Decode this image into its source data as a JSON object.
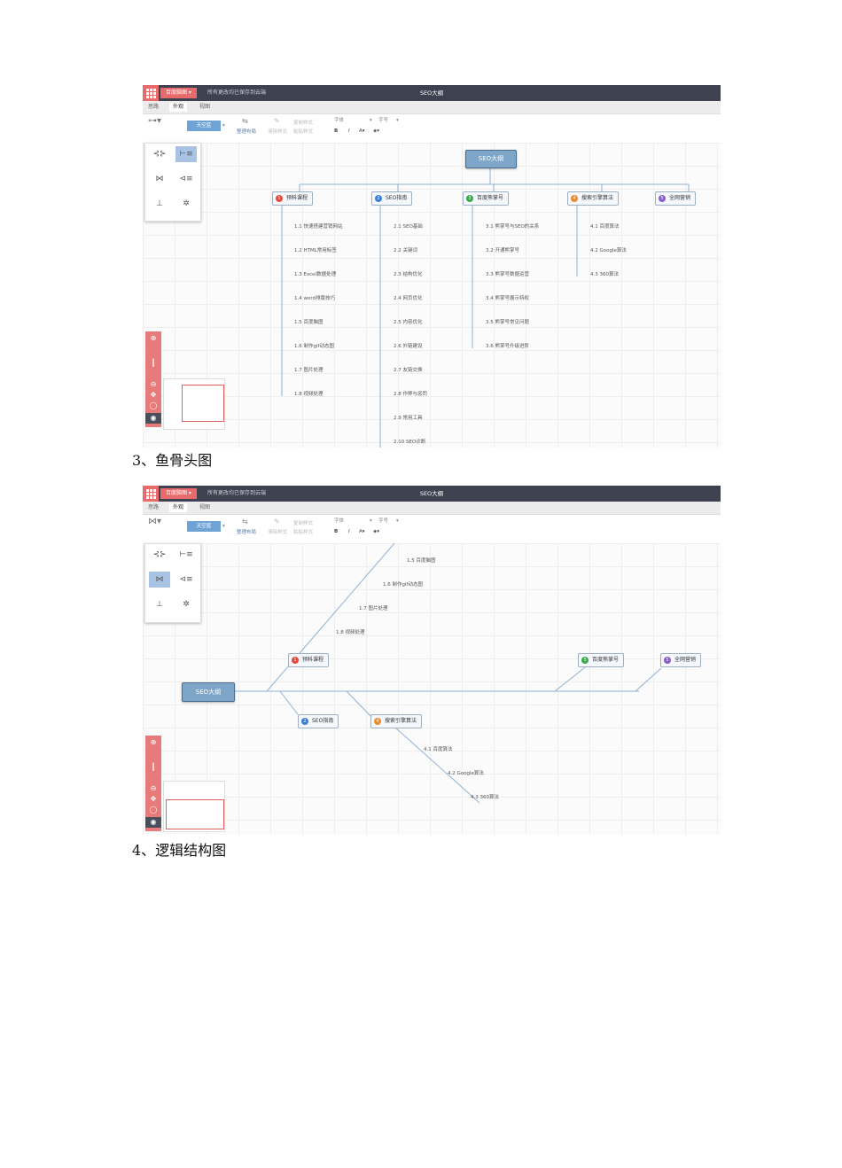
{
  "app": {
    "brand": "百度脑图 ▾",
    "save_status": "所有更改均已保存到云端",
    "doc_title": "SEO大纲",
    "tabs": [
      "思路",
      "外观",
      "视图"
    ],
    "toolbar": {
      "theme_button": "天空蓝",
      "arrange": "整理布局",
      "clear_style": "清除样式",
      "copy_style": "复制样式",
      "paste_style": "粘贴样式",
      "font_label": "字体",
      "size_label": "字号",
      "bold": "B",
      "italic": "I",
      "font_color": "A▾"
    }
  },
  "colors": {
    "titlebar": "#3d4150",
    "accent": "#e86a6a",
    "node_border": "#9fb0c4",
    "root": "#7ea6c8"
  },
  "mindmap": {
    "root": "SEO大纲",
    "branches": [
      {
        "num": "1",
        "label": "预科课程",
        "color": "#e24a3b",
        "items": [
          "1.1 快速搭建营销网站",
          "1.2 HTML常用标签",
          "1.3 Excel数据处理",
          "1.4 word排版技巧",
          "1.5 百度脑图",
          "1.6 制作gif动态图",
          "1.7 图片处理",
          "1.8 视频处理"
        ]
      },
      {
        "num": "2",
        "label": "SEO指南",
        "color": "#3b7fd6",
        "items": [
          "2.1 SEO基础",
          "2.2 关键词",
          "2.3 结构优化",
          "2.4 网页优化",
          "2.5 内容优化",
          "2.6 外链建设",
          "2.7 友链交换",
          "2.8 作弊与惩罚",
          "2.9 常用工具",
          "2.10 SEO诊断"
        ]
      },
      {
        "num": "3",
        "label": "百度熊掌号",
        "color": "#3aa94a",
        "items": [
          "3.1 熊掌号与SEO的关系",
          "3.2 开通熊掌号",
          "3.3 熊掌号数据运营",
          "3.4 熊掌号展示特权",
          "3.5 熊掌号常见问题",
          "3.6 熊掌号升级进阶"
        ]
      },
      {
        "num": "4",
        "label": "搜索引擎算法",
        "color": "#ef8a2b",
        "items": [
          "4.1 百度算法",
          "4.2 Google算法",
          "4.3 360算法"
        ]
      },
      {
        "num": "5",
        "label": "全网营销",
        "color": "#8a5cc7",
        "items": []
      }
    ]
  },
  "captions": {
    "fishbone": "3、鱼骨头图",
    "logic": "4、逻辑结构图"
  }
}
